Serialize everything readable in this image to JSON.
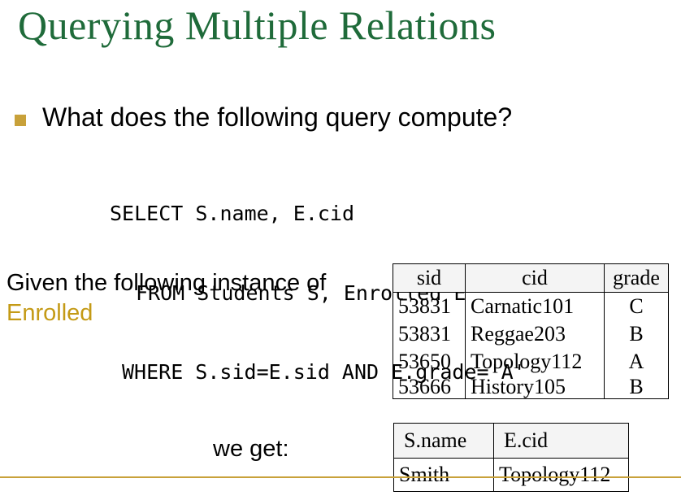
{
  "slide": {
    "title": "Querying Multiple Relations",
    "bullet": "What does the following query compute?",
    "sql": [
      "SELECT S.name, E.cid",
      "FROM Students S, Enrolled E",
      "WHERE S.sid=E.sid AND E.grade='A'"
    ],
    "given_prefix": "Given the following instance of",
    "given_table_name": "Enrolled",
    "we_get": "we get:",
    "accent_color": "#c8a13a",
    "title_color": "#1f6b3a"
  },
  "enrolled": {
    "headers": [
      "sid",
      "cid",
      "grade"
    ],
    "rows": [
      [
        "53831",
        "Carnatic101",
        "C"
      ],
      [
        "53831",
        "Reggae203",
        "B"
      ],
      [
        "53650",
        "Topology112",
        "A"
      ],
      [
        "53666",
        "History105",
        "B"
      ]
    ]
  },
  "result": {
    "headers": [
      "S.name",
      "E.cid"
    ],
    "rows": [
      [
        "Smith",
        "Topology112"
      ]
    ]
  }
}
